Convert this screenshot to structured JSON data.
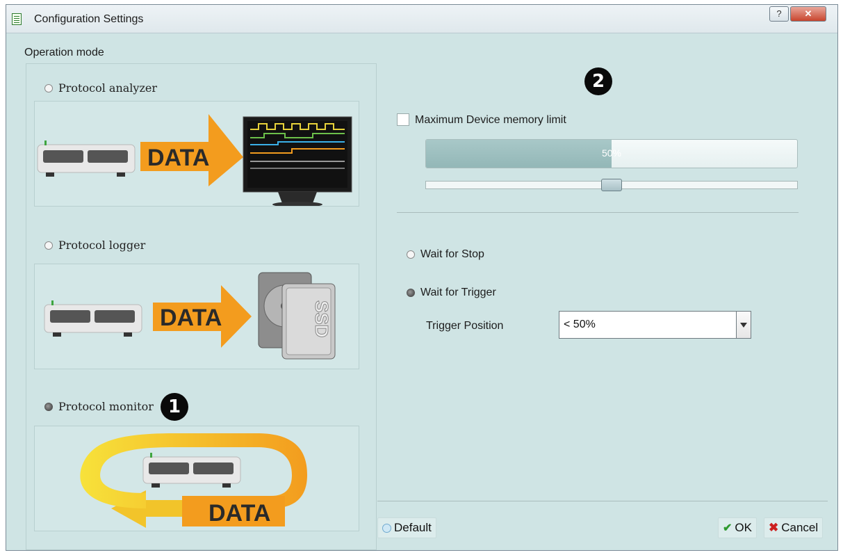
{
  "window": {
    "title": "Configuration Settings",
    "help_label": "?",
    "close_label": "✕"
  },
  "operation_mode": {
    "label": "Operation mode",
    "options": [
      {
        "label": "Protocol analyzer",
        "selected": false,
        "image_text": "DATA"
      },
      {
        "label": "Protocol logger",
        "selected": false,
        "image_text": "DATA",
        "disk_label": "SSD"
      },
      {
        "label": "Protocol monitor",
        "selected": true,
        "image_text": "DATA"
      }
    ],
    "annotation": "1"
  },
  "settings": {
    "annotation": "2",
    "memory_limit": {
      "label": "Maximum Device memory limit",
      "checked": false,
      "progress_text": "50%",
      "progress_value": 0.5,
      "slider_value": 0.5
    },
    "wait_for_stop": {
      "label": "Wait for Stop",
      "selected": false
    },
    "wait_for_trigger": {
      "label": "Wait for Trigger",
      "selected": true
    },
    "trigger_position": {
      "label": "Trigger Position",
      "value": "< 50%"
    }
  },
  "buttons": {
    "default_label": "Default",
    "ok_label": "OK",
    "cancel_label": "Cancel"
  },
  "colors": {
    "background": "#cfe4e4",
    "data_arrow": "#f39c1e",
    "progress_fill": "#9dbfbf"
  }
}
